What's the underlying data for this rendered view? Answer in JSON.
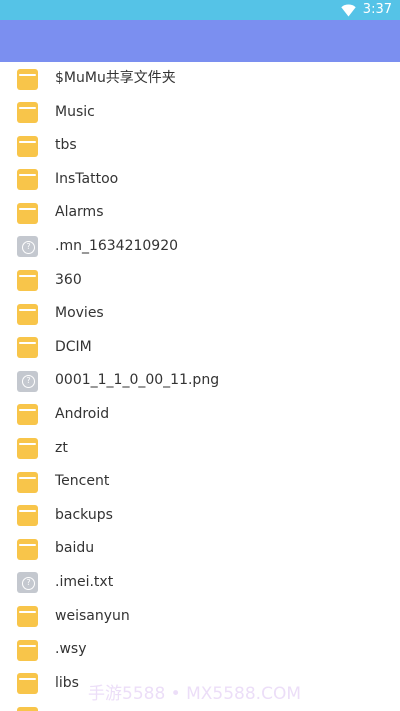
{
  "status_bar": {
    "time": "3:37",
    "wifi_icon": "wifi-icon"
  },
  "app_bar": {
    "color": "#7b8ff0"
  },
  "files": [
    {
      "name": "$MuMu共享文件夹",
      "icon": "folder-icon"
    },
    {
      "name": "Music",
      "icon": "folder-icon"
    },
    {
      "name": "tbs",
      "icon": "folder-icon"
    },
    {
      "name": "InsTattoo",
      "icon": "folder-icon"
    },
    {
      "name": "Alarms",
      "icon": "folder-icon"
    },
    {
      "name": ".mn_1634210920",
      "icon": "unknown-file-icon"
    },
    {
      "name": "360",
      "icon": "folder-icon"
    },
    {
      "name": "Movies",
      "icon": "folder-icon"
    },
    {
      "name": "DCIM",
      "icon": "folder-icon"
    },
    {
      "name": "0001_1_1_0_00_11.png",
      "icon": "unknown-file-icon"
    },
    {
      "name": "Android",
      "icon": "folder-icon"
    },
    {
      "name": "zt",
      "icon": "folder-icon"
    },
    {
      "name": "Tencent",
      "icon": "folder-icon"
    },
    {
      "name": "backups",
      "icon": "folder-icon"
    },
    {
      "name": "baidu",
      "icon": "folder-icon"
    },
    {
      "name": ".imei.txt",
      "icon": "unknown-file-icon"
    },
    {
      "name": "weisanyun",
      "icon": "folder-icon"
    },
    {
      "name": ".wsy",
      "icon": "folder-icon"
    },
    {
      "name": "libs",
      "icon": "folder-icon"
    },
    {
      "name": "",
      "icon": "folder-icon"
    }
  ],
  "watermark": "手游5588 • MX5588.COM"
}
